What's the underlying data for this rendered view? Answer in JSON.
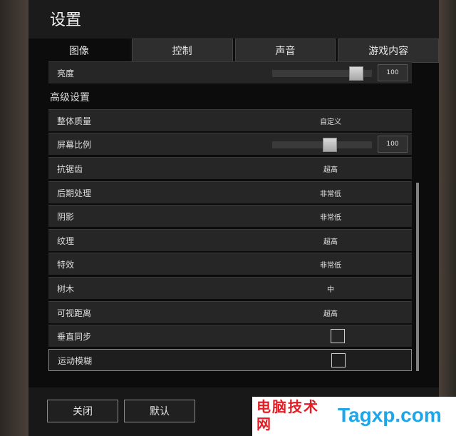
{
  "window": {
    "title": "设置"
  },
  "tabs": [
    {
      "label": "图像",
      "active": true
    },
    {
      "label": "控制",
      "active": false
    },
    {
      "label": "声音",
      "active": false
    },
    {
      "label": "游戏内容",
      "active": false
    }
  ],
  "brightness": {
    "label": "亮度",
    "value": "100",
    "level_fraction": 0.9
  },
  "section": {
    "title": "高级设置"
  },
  "settings": [
    {
      "label": "整体质量",
      "value": "自定义"
    },
    {
      "label": "屏幕比例",
      "value": "100",
      "level_fraction": 0.59
    },
    {
      "label": "抗锯齿",
      "value": "超高"
    },
    {
      "label": "后期处理",
      "value": "非常低"
    },
    {
      "label": "阴影",
      "value": "非常低"
    },
    {
      "label": "纹理",
      "value": "超高"
    },
    {
      "label": "特效",
      "value": "非常低"
    },
    {
      "label": "树木",
      "value": "中"
    },
    {
      "label": "可视距离",
      "value": "超高"
    },
    {
      "label": "垂直同步",
      "checked": false
    },
    {
      "label": "运动模糊",
      "checked": false
    }
  ],
  "buttons": {
    "close": "关闭",
    "default": "默认"
  },
  "watermark": {
    "cn": "电脑技术网",
    "en": "Tagxp.com"
  }
}
